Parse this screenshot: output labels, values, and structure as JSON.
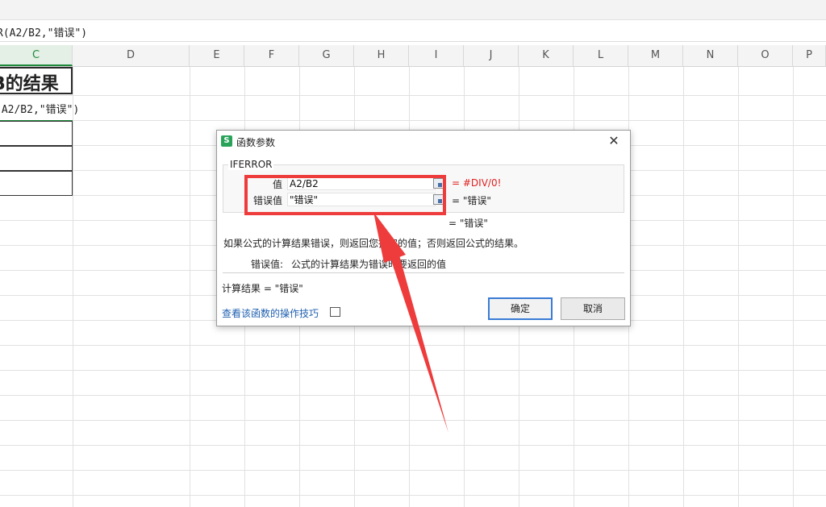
{
  "formula_bar": {
    "text": "R(A2/B2,\"错误\")"
  },
  "columns": [
    "C",
    "D",
    "E",
    "F",
    "G",
    "H",
    "I",
    "J",
    "K",
    "L",
    "M",
    "N",
    "O",
    "P"
  ],
  "active_column": "C",
  "sheet": {
    "title_cell": "B的结果",
    "formula_cell": "(A2/B2,\"错误\")"
  },
  "dialog": {
    "title": "函数参数",
    "app_icon": "S",
    "close_glyph": "✕",
    "function_name": "IFERROR",
    "params": [
      {
        "label": "值",
        "value": "A2/B2",
        "result": "= #DIV/0!"
      },
      {
        "label": "错误值",
        "value": "\"错误\"",
        "result": "= \"错误\""
      }
    ],
    "overall_result": "= \"错误\"",
    "description": "如果公式的计算结果错误，则返回您指定的值；否则返回公式的结果。",
    "param_help_label": "错误值:",
    "param_help_text": "公式的计算结果为错误时要返回的值",
    "calc_result": "计算结果 = \"错误\"",
    "help_link": "查看该函数的操作技巧",
    "ok_label": "确定",
    "cancel_label": "取消"
  },
  "colors": {
    "accent_green": "#1e8a3c",
    "annotation_red": "#ee3c3c",
    "error_red": "#e02020",
    "link_blue": "#2060b0"
  }
}
